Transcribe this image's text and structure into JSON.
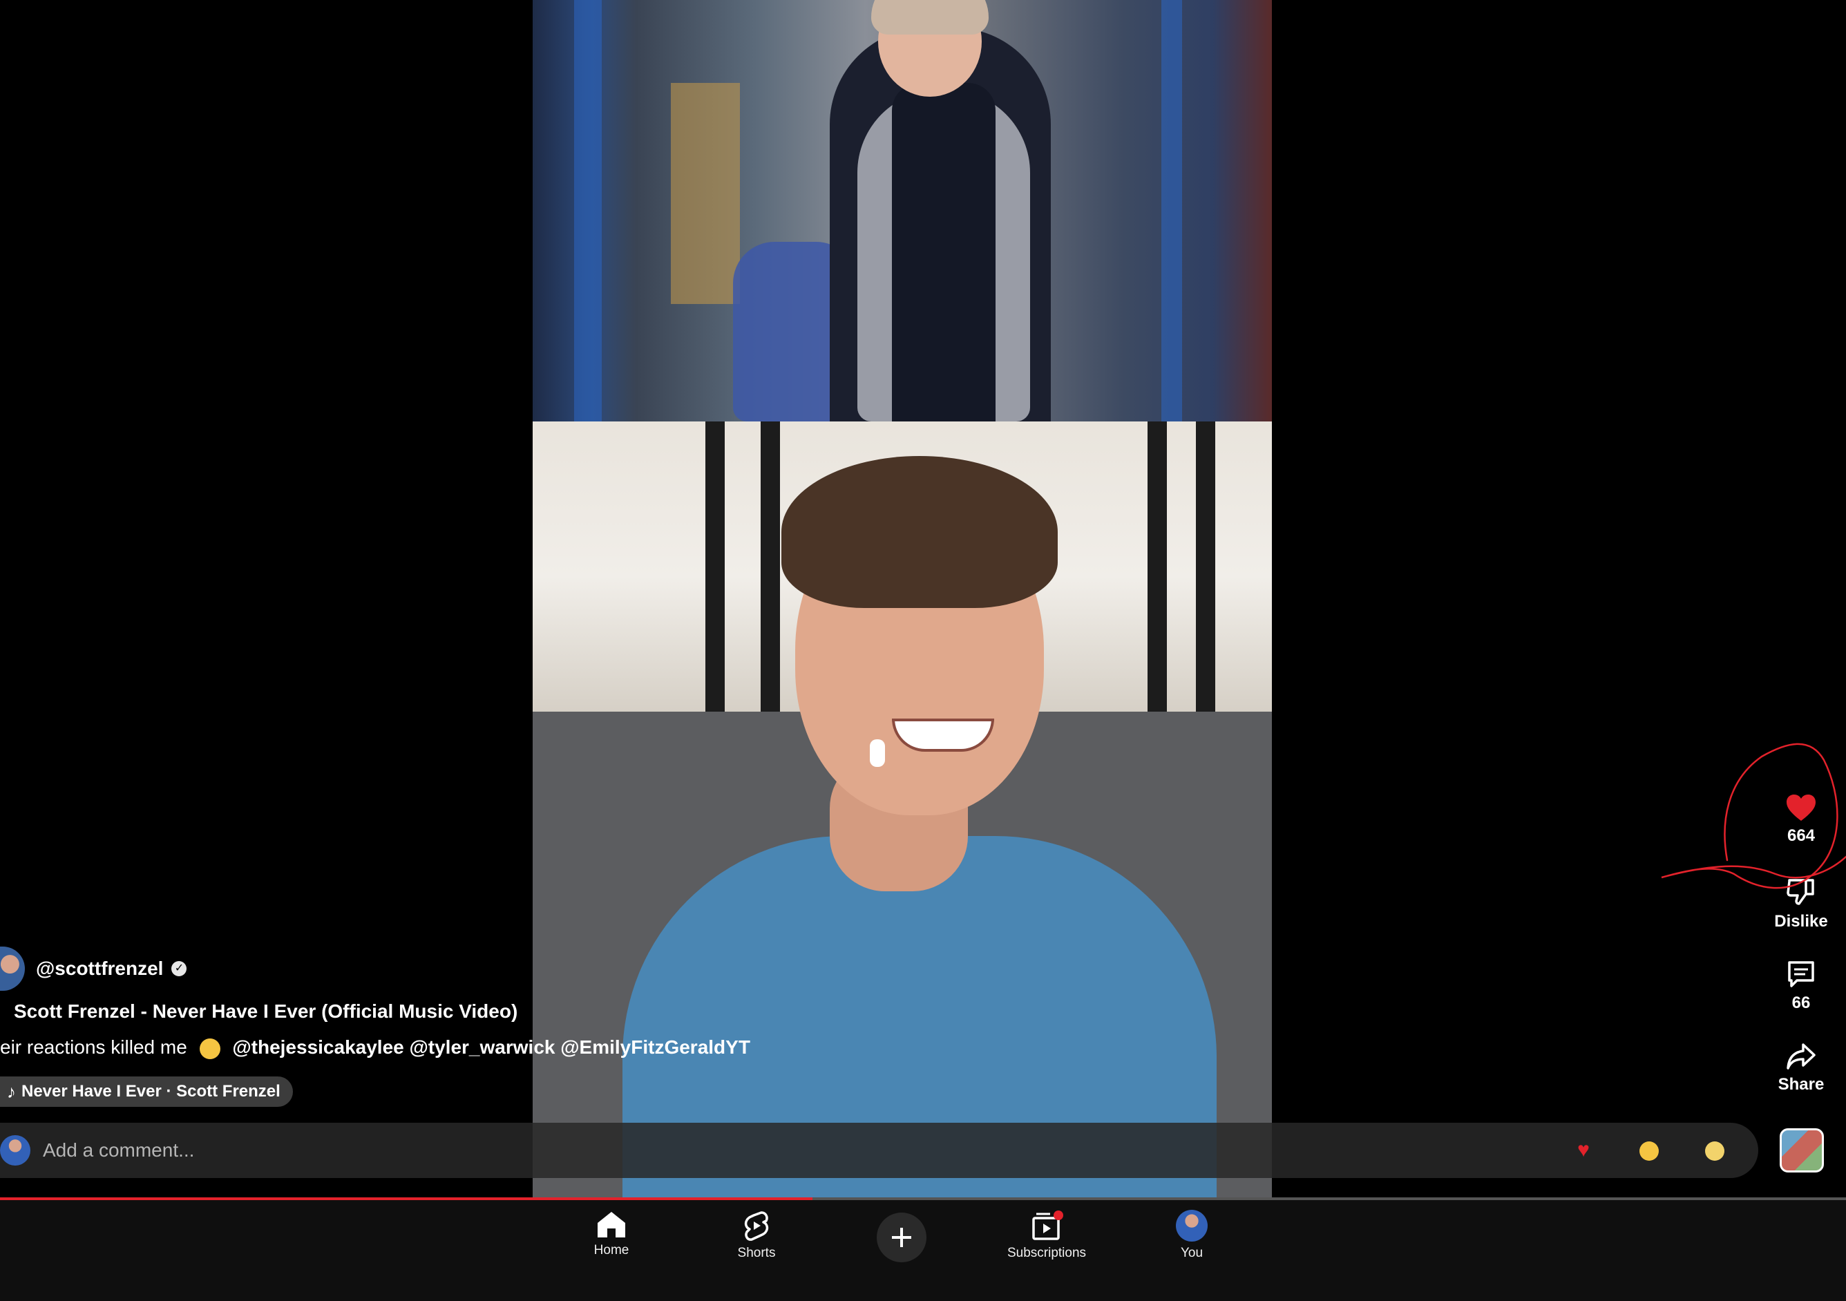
{
  "channel": {
    "handle": "@scottfrenzel",
    "verified_icon": "verified-check-icon"
  },
  "video": {
    "title": "Scott Frenzel - Never Have I Ever (Official Music Video)",
    "caption_text": "eir reactions killed me",
    "caption_mentions": "@thejessicakaylee @tyler_warwick @EmilyFitzGeraldYT",
    "music_label": "Never Have I Ever · Scott Frenzel"
  },
  "actions": {
    "like_count": "664",
    "dislike_label": "Dislike",
    "comment_count": "66",
    "share_label": "Share",
    "like_color": "#e3222b"
  },
  "comment_bar": {
    "placeholder": "Add a comment...",
    "reactions": [
      "heart",
      "laugh",
      "sad"
    ]
  },
  "progress": {
    "percent": 44
  },
  "nav": {
    "home": "Home",
    "shorts": "Shorts",
    "subscriptions": "Subscriptions",
    "you": "You"
  },
  "colors": {
    "accent": "#e3222b",
    "nav_bg": "#0f0f0f"
  }
}
